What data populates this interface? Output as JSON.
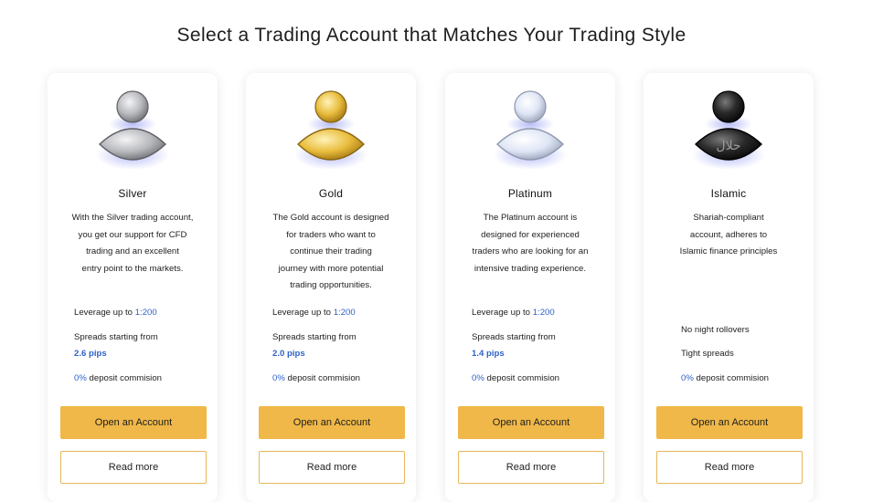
{
  "page": {
    "title": "Select a Trading Account that Matches Your Trading Style"
  },
  "cards": [
    {
      "name": "Silver",
      "icon": "silver-user-icon",
      "description": [
        "With the Silver trading account,",
        "you get our support for CFD",
        "trading and an excellent",
        "entry point to the markets."
      ],
      "leverage_label": "Leverage up to",
      "leverage_value": "1:200",
      "spreads_label": "Spreads starting from",
      "spreads_value": "2.6 pips",
      "deposit_value": "0%",
      "deposit_label": " deposit commision",
      "open_label": "Open an Account",
      "read_label": "Read more"
    },
    {
      "name": "Gold",
      "icon": "gold-user-icon",
      "description": [
        "The Gold account is designed",
        "for traders who want to",
        "continue their trading",
        "journey with more potential",
        "trading opportunities."
      ],
      "leverage_label": "Leverage up to",
      "leverage_value": "1:200",
      "spreads_label": "Spreads starting from",
      "spreads_value": "2.0 pips",
      "deposit_value": "0%",
      "deposit_label": " deposit commision",
      "open_label": "Open an Account",
      "read_label": "Read more"
    },
    {
      "name": "Platinum",
      "icon": "platinum-user-icon",
      "description": [
        "The Platinum account is",
        "designed for experienced",
        "traders who are looking for an",
        "intensive trading experience."
      ],
      "leverage_label": "Leverage up to",
      "leverage_value": "1:200",
      "spreads_label": "Spreads starting from",
      "spreads_value": "1.4 pips",
      "deposit_value": "0%",
      "deposit_label": " deposit commision",
      "open_label": "Open an Account",
      "read_label": "Read more"
    },
    {
      "name": "Islamic",
      "icon": "islamic-halal-user-icon",
      "description": [
        "Shariah-compliant",
        "account, adheres to",
        "Islamic finance principles"
      ],
      "feature_1": "No night rollovers",
      "feature_2": "Tight spreads",
      "deposit_value": "0%",
      "deposit_label": " deposit commision",
      "open_label": "Open an Account",
      "read_label": "Read more",
      "badge_text": "حلال"
    }
  ],
  "colors": {
    "accent": "#f0b848",
    "highlight": "#2e62c9",
    "silver": "#b8b9bd",
    "gold": "#e7b83a",
    "platinum": "#dde4f2",
    "islamic": "#1f1f1f"
  }
}
